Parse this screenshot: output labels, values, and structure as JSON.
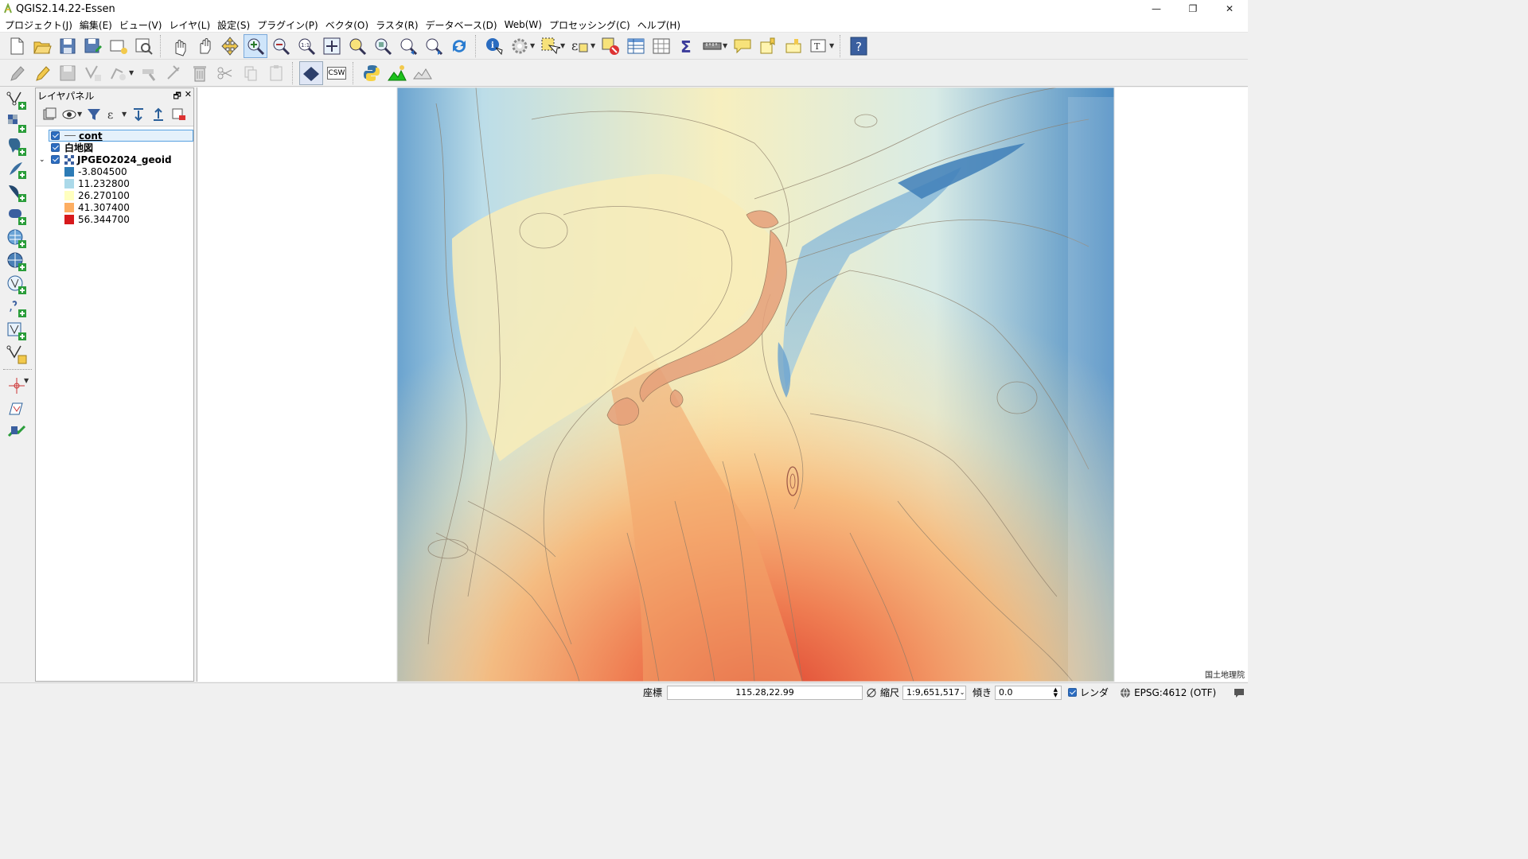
{
  "window": {
    "title": "QGIS2.14.22-Essen",
    "minimize": "—",
    "restore": "❐",
    "close": "✕"
  },
  "menu": [
    "プロジェクト(J)",
    "編集(E)",
    "ビュー(V)",
    "レイヤ(L)",
    "設定(S)",
    "プラグイン(P)",
    "ベクタ(O)",
    "ラスタ(R)",
    "データベース(D)",
    "Web(W)",
    "プロセッシング(C)",
    "ヘルプ(H)"
  ],
  "toolbar": {
    "csw_label": "CSW"
  },
  "layers_panel": {
    "title": "レイヤパネル",
    "layers": [
      {
        "name": "cont",
        "checked": true,
        "selected": true
      },
      {
        "name": "白地図",
        "checked": true
      },
      {
        "name": "JPGEO2024_geoid",
        "checked": true,
        "expanded": true
      }
    ],
    "legend": [
      {
        "value": "-3.804500",
        "color": "#2c7bb6"
      },
      {
        "value": "11.232800",
        "color": "#abd9e9"
      },
      {
        "value": "26.270100",
        "color": "#ffffbf"
      },
      {
        "value": "41.307400",
        "color": "#fdae61"
      },
      {
        "value": "56.344700",
        "color": "#d7191c"
      }
    ]
  },
  "map": {
    "attribution": "国土地理院"
  },
  "statusbar": {
    "coord_label": "座標",
    "coord_value": "115.28,22.99",
    "scale_label": "縮尺",
    "scale_value": "1:9,651,517",
    "rotation_label": "傾き",
    "rotation_value": "0.0",
    "render_label": "レンダ",
    "crs": "EPSG:4612 (OTF)"
  }
}
